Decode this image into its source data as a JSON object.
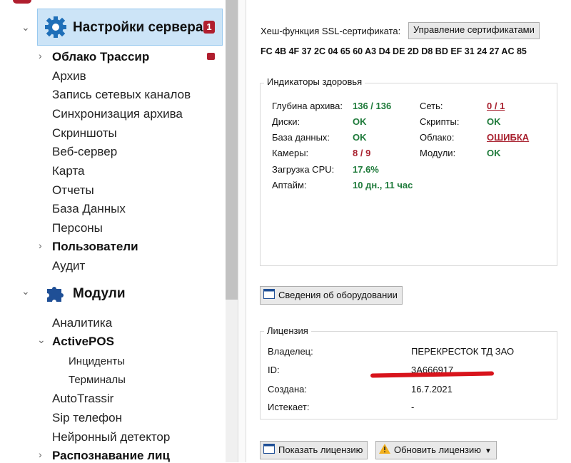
{
  "sidebar": {
    "server_settings": {
      "label": "Настройки сервера",
      "badge": "1"
    },
    "items": [
      {
        "label": "Облако Трассир",
        "bold": true,
        "chevron": true
      },
      {
        "label": "Архив"
      },
      {
        "label": "Запись сетевых каналов"
      },
      {
        "label": "Синхронизация архива"
      },
      {
        "label": "Скриншоты"
      },
      {
        "label": "Веб-сервер"
      },
      {
        "label": "Карта"
      },
      {
        "label": "Отчеты"
      },
      {
        "label": "База Данных"
      },
      {
        "label": "Персоны"
      },
      {
        "label": "Пользователи",
        "bold": true,
        "chevron": true
      },
      {
        "label": "Аудит"
      }
    ],
    "modules": {
      "label": "Модули"
    },
    "module_items": [
      {
        "label": "Аналитика"
      },
      {
        "label": "ActivePOS",
        "bold": true,
        "expanded": true
      },
      {
        "label": "Инциденты",
        "sub": true
      },
      {
        "label": "Терминалы",
        "sub": true
      },
      {
        "label": "AutoTrassir"
      },
      {
        "label": "Sip телефон"
      },
      {
        "label": "Нейронный детектор"
      },
      {
        "label": "Распознавание лиц",
        "bold": true,
        "chevron": true
      }
    ]
  },
  "ssl": {
    "label": "Хеш-функция SSL-сертификата:",
    "manage_button": "Управление сертификатами",
    "hash": "FC 4B 4F 37 2C 04 65 60 A3 D4 DE 2D D8 BD EF 31 24 27 AC 85"
  },
  "health": {
    "title": "Индикаторы здоровья",
    "left": [
      {
        "label": "Глубина архива:",
        "value": "136 / 136",
        "status": "ok"
      },
      {
        "label": "Диски:",
        "value": "OK",
        "status": "ok"
      },
      {
        "label": "База данных:",
        "value": "OK",
        "status": "ok"
      },
      {
        "label": "Камеры:",
        "value": "8 / 9",
        "status": "bad"
      },
      {
        "label": "Загрузка CPU:",
        "value": "17.6%",
        "status": "ok"
      },
      {
        "label": "Аптайм:",
        "value": "10 дн., 11 час",
        "status": "ok"
      }
    ],
    "right": [
      {
        "label": "Сеть:",
        "value": "0 / 1",
        "status": "link"
      },
      {
        "label": "Скрипты:",
        "value": "OK",
        "status": "ok"
      },
      {
        "label": "Облако:",
        "value": "ОШИБКА",
        "status": "link"
      },
      {
        "label": "Модули:",
        "value": "OK",
        "status": "ok"
      }
    ]
  },
  "hardware_button": "Сведения об оборудовании",
  "license": {
    "title": "Лицензия",
    "rows": [
      {
        "label": "Владелец:",
        "value": "ПЕРЕКРЕСТОК ТД ЗАО"
      },
      {
        "label": "ID:",
        "value": "3A666917"
      },
      {
        "label": "Создана:",
        "value": "16.7.2021"
      },
      {
        "label": "Истекает:",
        "value": "-"
      }
    ]
  },
  "show_license_button": "Показать лицензию",
  "update_license_button": "Обновить лицензию",
  "colors": {
    "accent": "#b01e2e",
    "ok": "#1e7a3a",
    "selection": "#cce4f7",
    "gear": "#1f6fb8"
  }
}
